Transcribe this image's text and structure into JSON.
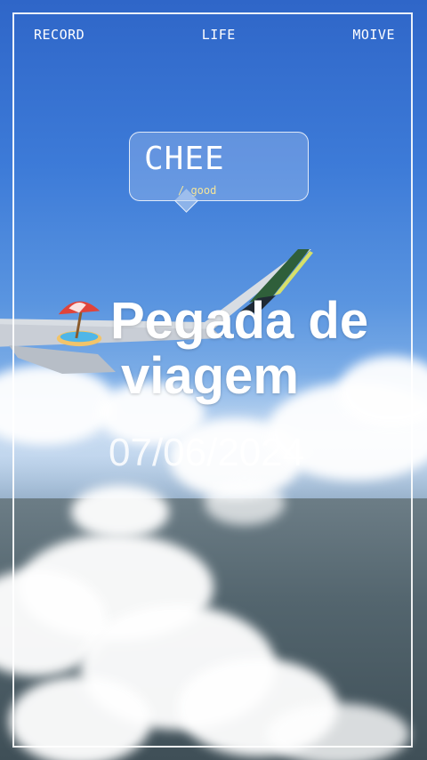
{
  "nav": {
    "left": "RECORD",
    "center": "LIFE",
    "right": "MOIVE"
  },
  "bubble": {
    "title": "CHEE",
    "subtitle": "/ good"
  },
  "headline": {
    "line1": "Pegada de",
    "line2": "viagem"
  },
  "date": "07/06/2024",
  "icons": {
    "emoji": "beach-umbrella-icon"
  }
}
